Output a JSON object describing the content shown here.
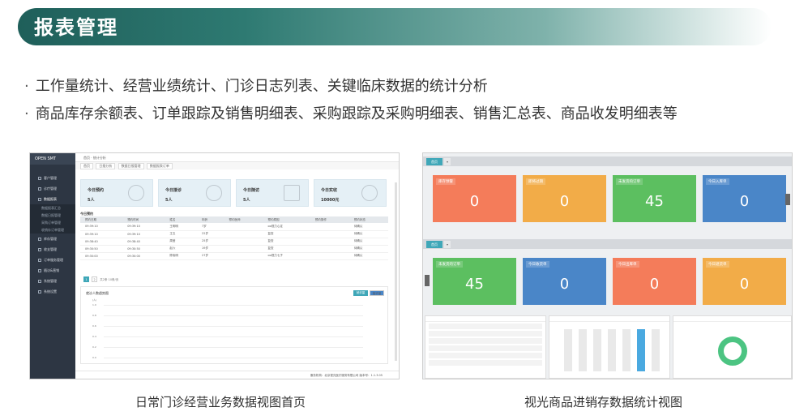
{
  "header": {
    "title": "报表管理"
  },
  "bullets": [
    "工作量统计、经营业绩统计、门诊日志列表、关键临床数据的统计分析",
    "商品库存余额表、订单跟踪及销售明细表、采购跟踪及采购明细表、销售汇总表、商品收发明细表等"
  ],
  "captions": {
    "left": "日常门诊经营业务数据视图首页",
    "right": "视光商品进销存数据统计视图"
  },
  "left_app": {
    "logo": "OPEN SMT",
    "sidebar": [
      "客户管理",
      "诊疗管理",
      "数据报表",
      "库存管理",
      "收支管理",
      "订单服务管理",
      "随访&营销",
      "系统管理",
      "系统设置"
    ],
    "sidebar_sub": [
      "数据报表汇总",
      "数据日报管理",
      "采购订单管理",
      "收销存订单管理"
    ],
    "topbar": "首页 · 统计分析",
    "tabs": [
      "首页",
      "日报分析",
      "数据日报管理",
      "数据报表订单"
    ],
    "cards": [
      {
        "title": "今日预约",
        "value": "5人"
      },
      {
        "title": "今日接诊",
        "value": "5人"
      },
      {
        "title": "今日随访",
        "value": "5人"
      },
      {
        "title": "今日实收",
        "value": "10000元"
      }
    ],
    "section": "今日预约",
    "table_headers": [
      "预约日期",
      "预约时间",
      "姓名",
      "年龄",
      "预约医师",
      "预约原因",
      "预约操作",
      "预约状态"
    ],
    "table_rows": [
      [
        "09:39:10",
        "09:39:10",
        "王明明",
        "7岁",
        "",
        "oo视力心定",
        "",
        "待确认"
      ],
      [
        "09:39:10",
        "09:39:10",
        "王五",
        "22岁",
        "",
        "复查",
        "",
        "待确认"
      ],
      [
        "09:38:40",
        "09:38:40",
        "周莹",
        "25岁",
        "",
        "复查",
        "",
        "待确认"
      ],
      [
        "09:30:50",
        "09:30:50",
        "赵六",
        "19岁",
        "",
        "复查",
        "",
        "待确认"
      ],
      [
        "09:30:00",
        "09:30:00",
        "陈晓明",
        "27岁",
        "",
        "oo视力七子",
        "",
        "待确认"
      ]
    ],
    "pager": {
      "pages": [
        "1",
        "2"
      ],
      "info": "共2条  10条/页"
    },
    "chart": {
      "title": "就诊人数趋势图",
      "btn_a": "就诊量",
      "btn_b": "接诊量",
      "unit": "(人)",
      "ticks": [
        "1.0",
        "0.8",
        "0.6",
        "0.4",
        "0.2",
        "0.0"
      ]
    },
    "footer": "服务机构：北京视光医疗服务有限公司  版本号：1.1.3.05"
  },
  "right_app": {
    "tab_label": "首页",
    "tiles_top": [
      {
        "title": "库存预警",
        "value": "0",
        "color": "o"
      },
      {
        "title": "即将过期",
        "value": "0",
        "color": "y"
      },
      {
        "title": "未发货的订单",
        "value": "45",
        "color": "g"
      },
      {
        "title": "今日入库单",
        "value": "0",
        "color": "b"
      }
    ],
    "tiles_bottom": [
      {
        "title": "未发货的订单",
        "value": "45",
        "color": "g"
      },
      {
        "title": "今日收货单",
        "value": "0",
        "color": "b"
      },
      {
        "title": "今日出库单",
        "value": "0",
        "color": "o"
      },
      {
        "title": "今日退货单",
        "value": "0",
        "color": "y"
      }
    ]
  }
}
